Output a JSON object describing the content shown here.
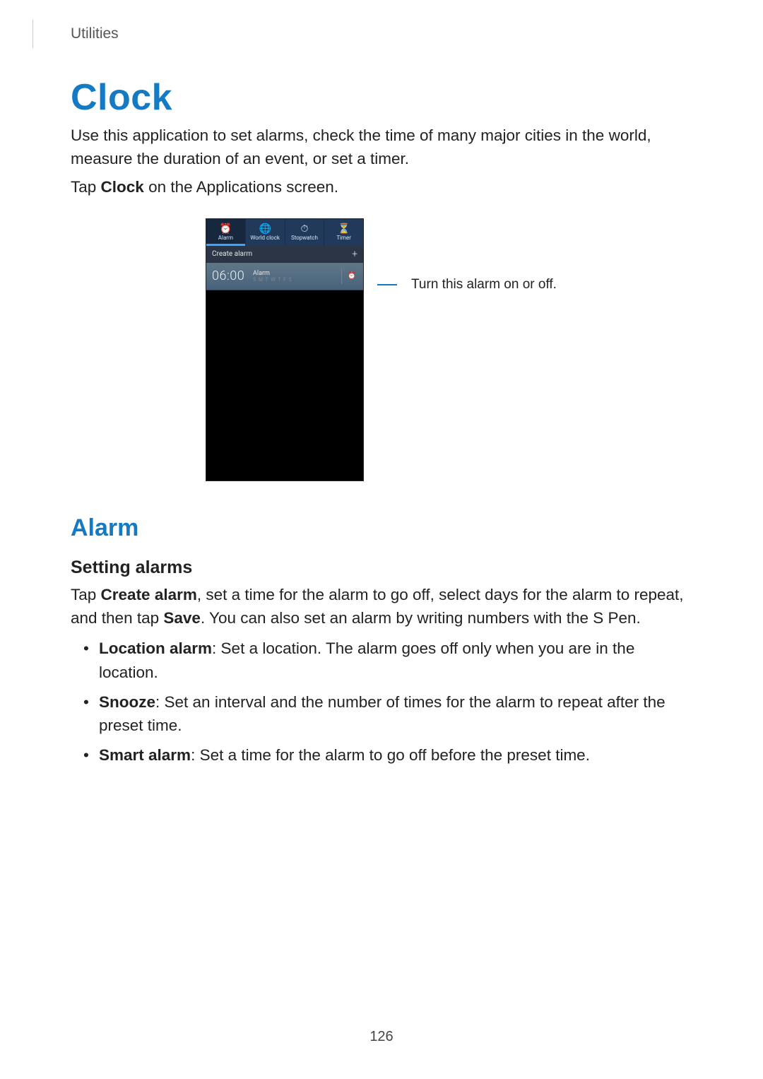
{
  "header": {
    "section": "Utilities"
  },
  "title": "Clock",
  "intro": "Use this application to set alarms, check the time of many major cities in the world, measure the duration of an event, or set a timer.",
  "tap_line_pre": "Tap ",
  "tap_line_bold": "Clock",
  "tap_line_post": " on the Applications screen.",
  "phone": {
    "tabs": [
      {
        "label": "Alarm",
        "icon": "⏰",
        "active": true
      },
      {
        "label": "World clock",
        "icon": "🌐",
        "active": false
      },
      {
        "label": "Stopwatch",
        "icon": "⏱",
        "active": false
      },
      {
        "label": "Timer",
        "icon": "⏳",
        "active": false
      }
    ],
    "create_label": "Create alarm",
    "plus": "+",
    "alarm": {
      "time": "06:00",
      "label": "Alarm",
      "days": "S M T W T F S",
      "toggle_icon": "⏰"
    }
  },
  "callout": "Turn this alarm on or off.",
  "alarm_heading": "Alarm",
  "setting_heading": "Setting alarms",
  "setting_body_parts": {
    "p1": "Tap ",
    "b1": "Create alarm",
    "p2": ", set a time for the alarm to go off, select days for the alarm to repeat, and then tap ",
    "b2": "Save",
    "p3": ". You can also set an alarm by writing numbers with the S Pen."
  },
  "bullets": [
    {
      "bold": "Location alarm",
      "rest": ": Set a location. The alarm goes off only when you are in the location."
    },
    {
      "bold": "Snooze",
      "rest": ": Set an interval and the number of times for the alarm to repeat after the preset time."
    },
    {
      "bold": "Smart alarm",
      "rest": ": Set a time for the alarm to go off before the preset time."
    }
  ],
  "page_number": "126"
}
